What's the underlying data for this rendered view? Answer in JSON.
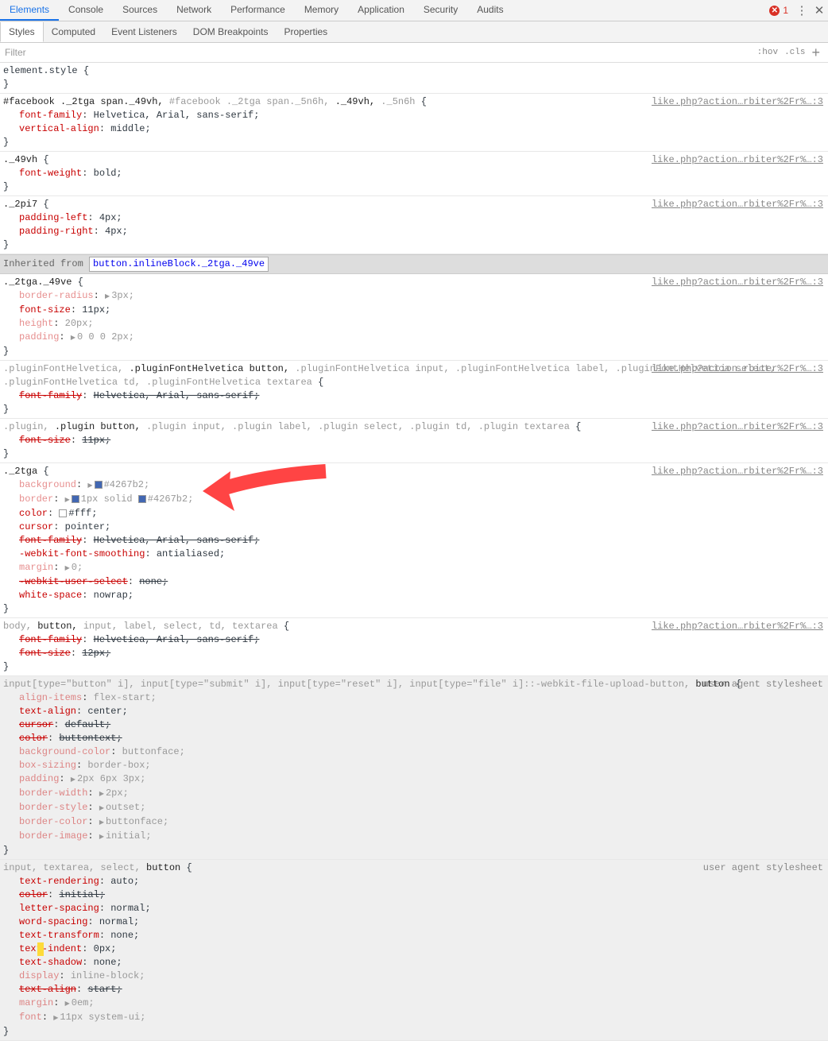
{
  "top_tabs": [
    "Elements",
    "Console",
    "Sources",
    "Network",
    "Performance",
    "Memory",
    "Application",
    "Security",
    "Audits"
  ],
  "active_top": 0,
  "error_count": "1",
  "sub_tabs": [
    "Styles",
    "Computed",
    "Event Listeners",
    "DOM Breakpoints",
    "Properties"
  ],
  "active_sub": 0,
  "filter": {
    "label": "Filter",
    "hov": ":hov",
    "cls": ".cls"
  },
  "inherited_label": "Inherited from ",
  "inherited_btn": "button.inlineBlock._2tga._49ve",
  "ua_source": "user agent stylesheet",
  "src_link": "like.php?action…rbiter%2Fr%…:3",
  "rules": [
    {
      "selector_parts": [
        {
          "t": "element.style ",
          "c": "sel"
        }
      ],
      "props": []
    },
    {
      "src": true,
      "selector_parts": [
        {
          "t": "#facebook ._2tga span._49vh, ",
          "c": "b"
        },
        {
          "t": "#facebook ._2tga span._5n6h, ",
          "c": "dim"
        },
        {
          "t": "._49vh, ",
          "c": "b"
        },
        {
          "t": "._5n6h",
          "c": "dim"
        }
      ],
      "props": [
        {
          "n": "font-family",
          "v": "Helvetica, Arial, sans-serif"
        },
        {
          "n": "vertical-align",
          "v": "middle"
        }
      ]
    },
    {
      "src": true,
      "selector_parts": [
        {
          "t": "._49vh",
          "c": "b"
        }
      ],
      "props": [
        {
          "n": "font-weight",
          "v": "bold"
        }
      ]
    },
    {
      "src": true,
      "selector_parts": [
        {
          "t": "._2pi7",
          "c": "b"
        }
      ],
      "props": [
        {
          "n": "padding-left",
          "v": "4px"
        },
        {
          "n": "padding-right",
          "v": "4px"
        }
      ]
    },
    {
      "inherited": true
    },
    {
      "src": true,
      "selector_parts": [
        {
          "t": "._2tga._49ve",
          "c": "b"
        }
      ],
      "props": [
        {
          "n": "border-radius",
          "v": "3px",
          "tri": true,
          "dim": true
        },
        {
          "n": "font-size",
          "v": "11px"
        },
        {
          "n": "height",
          "v": "20px",
          "dim": true
        },
        {
          "n": "padding",
          "v": "0 0 0 2px",
          "tri": true,
          "dim": true
        }
      ]
    },
    {
      "src": true,
      "selector_parts": [
        {
          "t": ".pluginFontHelvetica, ",
          "c": "dim"
        },
        {
          "t": ".pluginFontHelvetica button, ",
          "c": "b"
        },
        {
          "t": ".pluginFontHelvetica input, .pluginFontHelvetica label, .pluginFontHelvetica select, .pluginFontHelvetica td, .pluginFontHelvetica textarea",
          "c": "dim"
        }
      ],
      "props": [
        {
          "n": "font-family",
          "v": "Helvetica, Arial, sans-serif",
          "strike": true
        }
      ]
    },
    {
      "src": true,
      "selector_parts": [
        {
          "t": ".plugin, ",
          "c": "dim"
        },
        {
          "t": ".plugin button, ",
          "c": "b"
        },
        {
          "t": ".plugin input, .plugin label, .plugin select, .plugin td, .plugin textarea",
          "c": "dim"
        }
      ],
      "props": [
        {
          "n": "font-size",
          "v": "11px",
          "strike": true
        }
      ]
    },
    {
      "src": true,
      "arrow": true,
      "selector_parts": [
        {
          "t": "._2tga",
          "c": "b"
        }
      ],
      "props": [
        {
          "n": "background",
          "v": "#4267b2",
          "tri": true,
          "sw": "#4267b2",
          "dim": true
        },
        {
          "n": "border",
          "v": "1px solid ",
          "tri": true,
          "sw": "#4267b2",
          "sw_after": "#4267b2",
          "dim": true
        },
        {
          "n": "color",
          "v": "#fff",
          "sw": "#ffffff"
        },
        {
          "n": "cursor",
          "v": "pointer"
        },
        {
          "n": "font-family",
          "v": "Helvetica, Arial, sans-serif",
          "strike": true
        },
        {
          "n": "-webkit-font-smoothing",
          "v": "antialiased"
        },
        {
          "n": "margin",
          "v": "0",
          "tri": true,
          "dim": true
        },
        {
          "n": "-webkit-user-select",
          "v": "none",
          "strike": true
        },
        {
          "n": "white-space",
          "v": "nowrap"
        }
      ]
    },
    {
      "src": true,
      "selector_parts": [
        {
          "t": "body, ",
          "c": "dim"
        },
        {
          "t": "button, ",
          "c": "b"
        },
        {
          "t": "input, label, select, td, textarea",
          "c": "dim"
        }
      ],
      "props": [
        {
          "n": "font-family",
          "v": "Helvetica, Arial, sans-serif",
          "strike": true
        },
        {
          "n": "font-size",
          "v": "12px",
          "strike": true
        }
      ]
    },
    {
      "ua": true,
      "selector_parts": [
        {
          "t": "input[type=\"button\" i], input[type=\"submit\" i], input[type=\"reset\" i], input[type=\"file\" i]::-webkit-file-upload-button, ",
          "c": "dim"
        },
        {
          "t": "button",
          "c": "b"
        }
      ],
      "props": [
        {
          "n": "align-items",
          "v": "flex-start",
          "dim": true
        },
        {
          "n": "text-align",
          "v": "center"
        },
        {
          "n": "cursor",
          "v": "default",
          "strike": true
        },
        {
          "n": "color",
          "v": "buttontext",
          "strike": true
        },
        {
          "n": "background-color",
          "v": "buttonface",
          "dim": true
        },
        {
          "n": "box-sizing",
          "v": "border-box",
          "dim": true
        },
        {
          "n": "padding",
          "v": "2px 6px 3px",
          "tri": true,
          "dim": true
        },
        {
          "n": "border-width",
          "v": "2px",
          "tri": true,
          "dim": true
        },
        {
          "n": "border-style",
          "v": "outset",
          "tri": true,
          "dim": true
        },
        {
          "n": "border-color",
          "v": "buttonface",
          "tri": true,
          "dim": true
        },
        {
          "n": "border-image",
          "v": "initial",
          "tri": true,
          "dim": true
        }
      ]
    },
    {
      "ua": true,
      "cursor": true,
      "selector_parts": [
        {
          "t": "input, textarea, select, ",
          "c": "dim"
        },
        {
          "t": "button",
          "c": "b"
        }
      ],
      "props": [
        {
          "n": "text-rendering",
          "v": "auto"
        },
        {
          "n": "color",
          "v": "initial",
          "strike": true
        },
        {
          "n": "letter-spacing",
          "v": "normal"
        },
        {
          "n": "word-spacing",
          "v": "normal"
        },
        {
          "n": "text-transform",
          "v": "none"
        },
        {
          "n": "text-indent",
          "v": "0px"
        },
        {
          "n": "text-shadow",
          "v": "none"
        },
        {
          "n": "display",
          "v": "inline-block",
          "dim": true
        },
        {
          "n": "text-align",
          "v": "start",
          "strike": true
        },
        {
          "n": "margin",
          "v": "0em",
          "tri": true,
          "dim": true
        },
        {
          "n": "font",
          "v": "11px system-ui",
          "tri": true,
          "dim": true
        }
      ]
    }
  ]
}
